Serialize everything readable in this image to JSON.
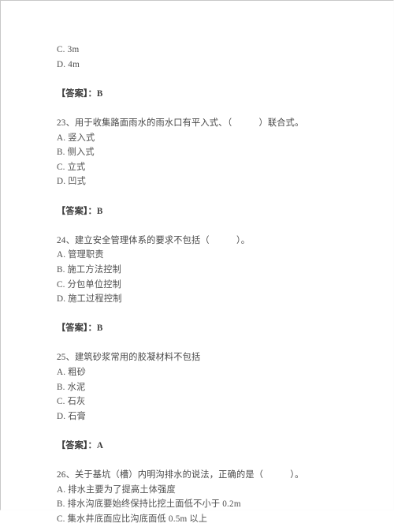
{
  "document": {
    "type": "exam-question-bank",
    "language": "zh-CN",
    "answer_label": "【答案】：",
    "background_color": "#ffffff",
    "text_color": "#4a4a4a",
    "border_color": "#c8c8c8"
  },
  "fragments": {
    "top_partial_options": [
      "C. 3m",
      "D. 4m"
    ],
    "top_answer": "【答案】：B"
  },
  "questions": [
    {
      "number": "23",
      "stem": "23、用于收集路面雨水的雨水口有平入式、（　　　）联合式。",
      "options": [
        "A. 竖入式",
        "B. 侧入式",
        "C. 立式",
        "D. 凹式"
      ],
      "answer": "【答案】：B"
    },
    {
      "number": "24",
      "stem": "24、建立安全管理体系的要求不包括（　　　）。",
      "options": [
        "A. 管理职责",
        "B. 施工方法控制",
        "C. 分包单位控制",
        "D. 施工过程控制"
      ],
      "answer": "【答案】：B"
    },
    {
      "number": "25",
      "stem": "25、建筑砂浆常用的胶凝材料不包括",
      "options": [
        "A. 粗砂",
        "B. 水泥",
        "C. 石灰",
        "D. 石膏"
      ],
      "answer": "【答案】：A"
    },
    {
      "number": "26",
      "stem": "26、关于基坑（槽）内明沟排水的说法，正确的是（　　　）。",
      "options": [
        "A. 排水主要为了提高土体强度",
        "B. 排水沟底要始终保持比挖土面低不小于 0.2m",
        "C. 集水井底面应比沟底面低 0.5m 以上"
      ],
      "answer": null
    }
  ]
}
